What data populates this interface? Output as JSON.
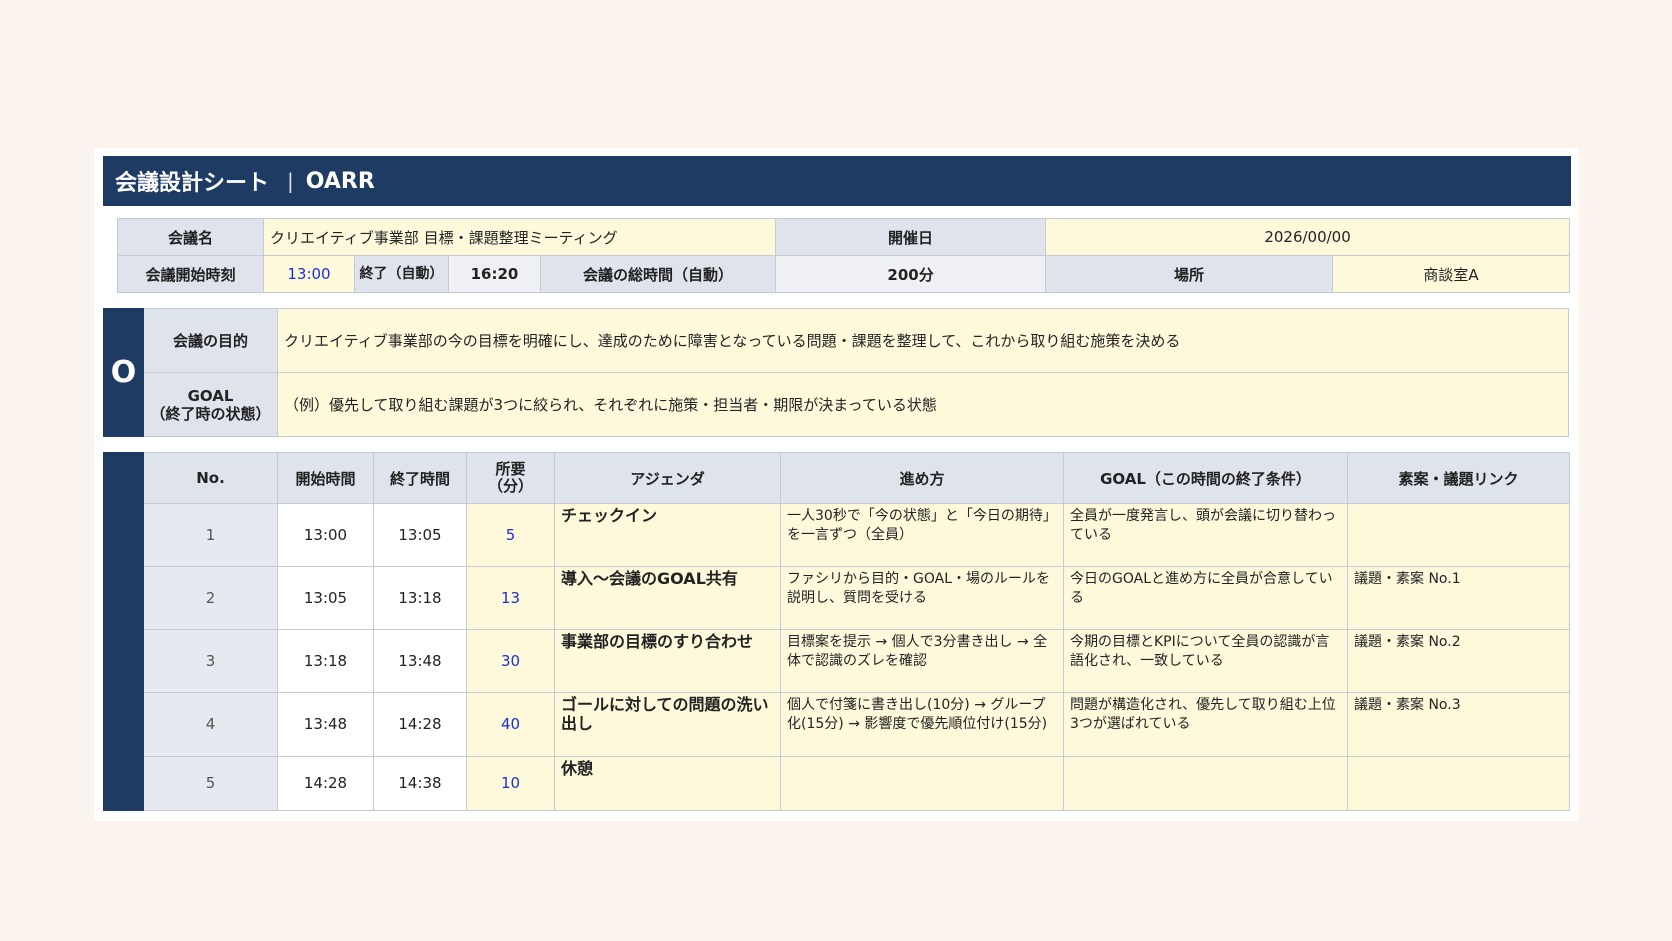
{
  "title": "会議設計シート",
  "title_sep": "|",
  "title_suffix": "OARR",
  "info": {
    "meeting_name_label": "会議名",
    "meeting_name": "クリエイティブ事業部 目標・課題整理ミーティング",
    "date_label": "開催日",
    "date": "2026/00/00",
    "start_label": "会議開始時刻",
    "start": "13:00",
    "end_label": "終了（自動）",
    "end": "16:20",
    "total_label": "会議の総時間（自動）",
    "total": "200分",
    "place_label": "場所",
    "place": "商談室A"
  },
  "objective": {
    "letter": "O",
    "purpose_label": "会議の目的",
    "purpose": "クリエイティブ事業部の今の目標を明確にし、達成のために障害となっている問題・課題を整理して、これから取り組む施策を決める",
    "goal_label": "GOAL",
    "goal_label2": "（終了時の状態）",
    "goal": "（例）優先して取り組む課題が3つに絞られ、それぞれに施策・担当者・期限が決まっている状態"
  },
  "agenda": {
    "headers": {
      "no": "No.",
      "start": "開始時間",
      "end": "終了時間",
      "dur": "所要（分）",
      "item": "アジェンダ",
      "method": "進め方",
      "goal": "GOAL（この時間の終了条件）",
      "link": "素案・議題リンク"
    },
    "rows": [
      {
        "no": "1",
        "start": "13:00",
        "end": "13:05",
        "dur": "5",
        "item": "チェックイン",
        "method": "一人30秒で「今の状態」と「今日の期待」を一言ずつ（全員）",
        "goal": "全員が一度発言し、頭が会議に切り替わっている",
        "link": ""
      },
      {
        "no": "2",
        "start": "13:05",
        "end": "13:18",
        "dur": "13",
        "item": "導入〜会議のGOAL共有",
        "method": "ファシリから目的・GOAL・場のルールを説明し、質問を受ける",
        "goal": "今日のGOALと進め方に全員が合意している",
        "link": "議題・素案 No.1"
      },
      {
        "no": "3",
        "start": "13:18",
        "end": "13:48",
        "dur": "30",
        "item": "事業部の目標のすり合わせ",
        "method": "目標案を提示 → 個人で3分書き出し → 全体で認識のズレを確認",
        "goal": "今期の目標とKPIについて全員の認識が言語化され、一致している",
        "link": "議題・素案 No.2"
      },
      {
        "no": "4",
        "start": "13:48",
        "end": "14:28",
        "dur": "40",
        "item": "ゴールに対しての問題の洗い出し",
        "method": "個人で付箋に書き出し(10分) → グループ化(15分) → 影響度で優先順位付け(15分)",
        "goal": "問題が構造化され、優先して取り組む上位3つが選ばれている",
        "link": "議題・素案 No.3"
      },
      {
        "no": "5",
        "start": "14:28",
        "end": "14:38",
        "dur": "10",
        "item": "休憩",
        "method": "",
        "goal": "",
        "link": ""
      }
    ]
  }
}
